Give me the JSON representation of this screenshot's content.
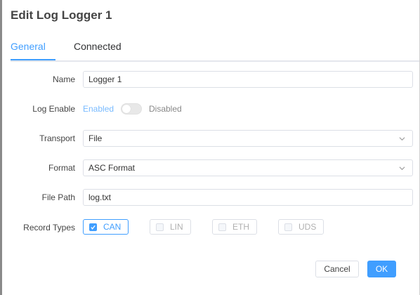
{
  "dialog": {
    "title": "Edit Log Logger 1"
  },
  "tabs": [
    {
      "label": "General",
      "active": true
    },
    {
      "label": "Connected",
      "active": false
    }
  ],
  "form": {
    "name": {
      "label": "Name",
      "value": "Logger 1"
    },
    "log_enable": {
      "label": "Log Enable",
      "on_text": "Enabled",
      "off_text": "Disabled",
      "enabled": false
    },
    "transport": {
      "label": "Transport",
      "value": "File"
    },
    "format": {
      "label": "Format",
      "value": "ASC Format"
    },
    "file_path": {
      "label": "File Path",
      "value": "log.txt"
    },
    "record_types": {
      "label": "Record Types",
      "options": [
        {
          "label": "CAN",
          "checked": true
        },
        {
          "label": "LIN",
          "checked": false
        },
        {
          "label": "ETH",
          "checked": false
        },
        {
          "label": "UDS",
          "checked": false
        }
      ]
    }
  },
  "footer": {
    "cancel_label": "Cancel",
    "ok_label": "OK"
  },
  "colors": {
    "accent": "#409eff",
    "border": "#dcdfe6"
  },
  "icons": {
    "select_arrow": "chevron-down-icon",
    "check": "check-icon"
  }
}
